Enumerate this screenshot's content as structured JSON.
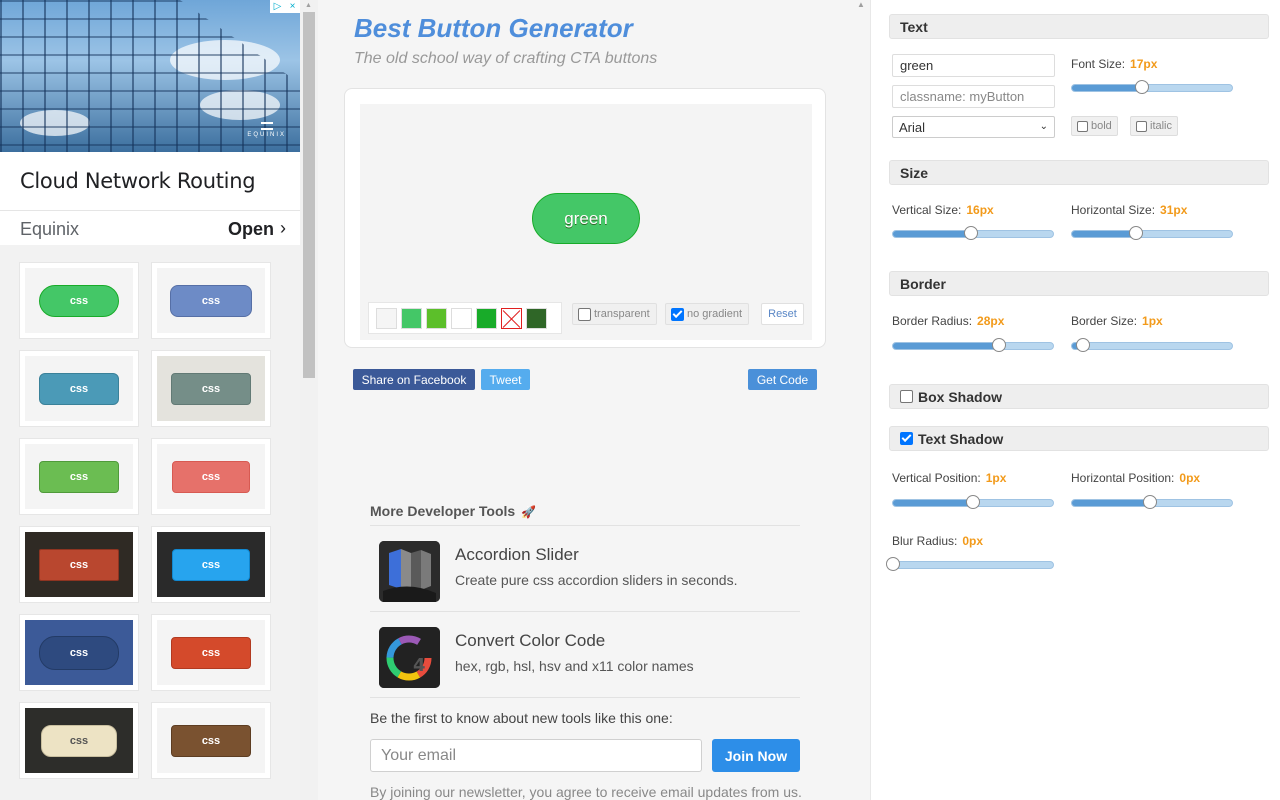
{
  "ad": {
    "headline": "Cloud Network Routing",
    "advertiser": "Equinix",
    "cta": "Open",
    "brand_mark": "EQUINIX",
    "choices_icon": "adchoices-icon",
    "close_glyph": "×",
    "info_glyph": "▷"
  },
  "presets": [
    {
      "label": "css",
      "bg": "#f4f4f4",
      "btn": "#44c767",
      "border": "#18ab29",
      "radius": "28px",
      "w": 80,
      "h": 32
    },
    {
      "label": "css",
      "bg": "#f4f4f4",
      "btn": "#6d8bc6",
      "border": "#566fa6",
      "radius": "8px",
      "w": 82,
      "h": 32
    },
    {
      "label": "css",
      "bg": "#f4f4f4",
      "btn": "#4b9ab7",
      "border": "#3a8199",
      "radius": "6px",
      "w": 80,
      "h": 32
    },
    {
      "label": "css",
      "bg": "#e4e3dd",
      "btn": "#758e88",
      "border": "#627a75",
      "radius": "4px",
      "w": 80,
      "h": 32
    },
    {
      "label": "css",
      "bg": "#f4f4f4",
      "btn": "#6bbd52",
      "border": "#4f9a3a",
      "radius": "4px",
      "w": 80,
      "h": 32
    },
    {
      "label": "css",
      "bg": "#f4f4f4",
      "btn": "#e6716a",
      "border": "#d75a52",
      "radius": "4px",
      "w": 78,
      "h": 32
    },
    {
      "label": "css",
      "bg": "#2f2a24",
      "btn": "#b9472f",
      "border": "#8e3421",
      "radius": "2px",
      "w": 80,
      "h": 32
    },
    {
      "label": "css",
      "bg": "#2a2a2a",
      "btn": "#27a4ee",
      "border": "#1188d0",
      "radius": "4px",
      "w": 78,
      "h": 32
    },
    {
      "label": "css",
      "bg": "#3c5a98",
      "btn": "#2e4a7f",
      "border": "#233b66",
      "radius": "16px",
      "w": 80,
      "h": 34
    },
    {
      "label": "css",
      "bg": "#f4f4f4",
      "btn": "#d44a2b",
      "border": "#b23a20",
      "radius": "4px",
      "w": 80,
      "h": 32
    },
    {
      "label": "css",
      "bg": "#2d2d2a",
      "btn": "#ede3c4",
      "border": "#c9bf9f",
      "radius": "10px",
      "w": 76,
      "h": 32,
      "fg": "#555"
    },
    {
      "label": "css",
      "bg": "#f4f4f4",
      "btn": "#7a5230",
      "border": "#5d3d22",
      "radius": "4px",
      "w": 80,
      "h": 32
    }
  ],
  "header": {
    "title": "Best Button Generator",
    "subtitle": "The old school way of crafting CTA buttons"
  },
  "preview": {
    "button_text": "green",
    "swatches": [
      "#f5f5f5",
      "#44c767",
      "#5cbf2a",
      "#ffffff",
      "#18ab29",
      "none",
      "#2f6627"
    ],
    "transparent_label": "transparent",
    "transparent_checked": false,
    "no_gradient_label": "no gradient",
    "no_gradient_checked": true,
    "reset_label": "Reset"
  },
  "actions": {
    "facebook_label": "Share on Facebook",
    "tweet_label": "Tweet",
    "get_code_label": "Get Code"
  },
  "more_tools": {
    "title": "More Developer Tools",
    "rocket_glyph": "🚀",
    "items": [
      {
        "name": "Accordion Slider",
        "description": "Create pure css accordion sliders in seconds.",
        "icon": "accordion-slider-icon"
      },
      {
        "name": "Convert Color Code",
        "description": "hex, rgb, hsl, hsv and x11 color names",
        "icon": "color-code-icon"
      }
    ]
  },
  "newsletter": {
    "prompt": "Be the first to know about new tools like this one:",
    "email_placeholder": "Your email",
    "join_label": "Join Now",
    "disclaimer": "By joining our newsletter, you agree to receive email updates from us."
  },
  "settings": {
    "text": {
      "heading": "Text",
      "button_text_value": "green",
      "classname_placeholder": "classname: myButton",
      "font_family": "Arial",
      "font_size_label": "Font Size:",
      "font_size_value": "17px",
      "font_size_fraction": 0.44,
      "bold_label": "bold",
      "italic_label": "italic"
    },
    "size": {
      "heading": "Size",
      "vertical_label": "Vertical Size:",
      "vertical_value": "16px",
      "vertical_fraction": 0.49,
      "horizontal_label": "Horizontal Size:",
      "horizontal_value": "31px",
      "horizontal_fraction": 0.4
    },
    "border": {
      "heading": "Border",
      "radius_label": "Border Radius:",
      "radius_value": "28px",
      "radius_fraction": 0.66,
      "size_label": "Border Size:",
      "size_value": "1px",
      "size_fraction": 0.07
    },
    "box_shadow": {
      "heading": "Box Shadow",
      "checked": false
    },
    "text_shadow": {
      "heading": "Text Shadow",
      "checked": true,
      "vertical_label": "Vertical Position:",
      "vertical_value": "1px",
      "vertical_fraction": 0.5,
      "horizontal_label": "Horizontal Position:",
      "horizontal_value": "0px",
      "horizontal_fraction": 0.49,
      "blur_label": "Blur Radius:",
      "blur_value": "0px",
      "blur_fraction": 0.0
    }
  }
}
